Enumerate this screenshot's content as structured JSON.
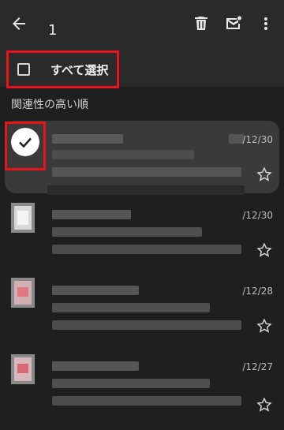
{
  "toolbar": {
    "selected_count": "1",
    "back_icon": "arrow-left-icon",
    "delete_icon": "trash-icon",
    "mark_unread_icon": "mail-dot-icon",
    "more_icon": "more-vert-icon"
  },
  "select_all": {
    "label": "すべて選択",
    "checked": false
  },
  "section": {
    "label": "関連性の高い順"
  },
  "emails": [
    {
      "date": "/12/30",
      "selected": true,
      "starred": false
    },
    {
      "date": "/12/30",
      "selected": false,
      "starred": false
    },
    {
      "date": "/12/28",
      "selected": false,
      "starred": false
    },
    {
      "date": "/12/27",
      "selected": false,
      "starred": false
    }
  ],
  "colors": {
    "background": "#1f1f1f",
    "appbar": "#2a2a2a",
    "highlight": "#e8141b",
    "selected_row": "#3a3a3a"
  }
}
